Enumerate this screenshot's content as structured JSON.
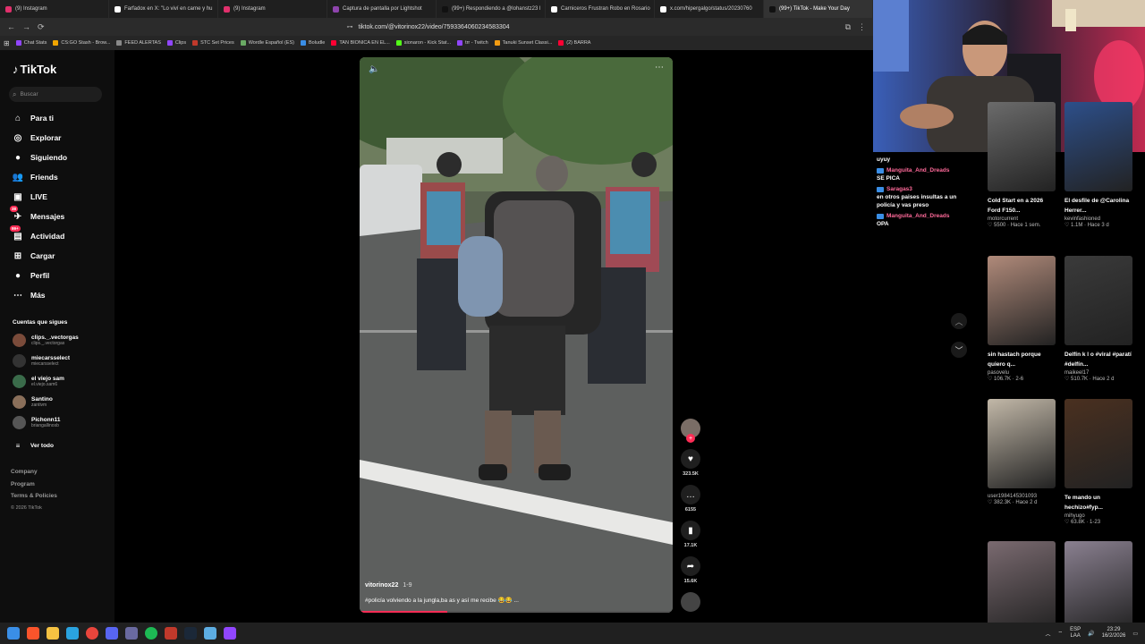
{
  "browser": {
    "tabs": [
      {
        "label": "(9) Instagram",
        "color": "#e1306c"
      },
      {
        "label": "Farfadox en X: \"Lo viví en carne y hu",
        "color": "#ffffff"
      },
      {
        "label": "(9) Instagram",
        "color": "#e1306c"
      },
      {
        "label": "Captura de pantalla por Lightshot",
        "color": "#8e44ad"
      },
      {
        "label": "(99+) Respondiendo a @lohanstz23 l",
        "color": "#111111"
      },
      {
        "label": "Carniceros Frustran Robo en Rosario",
        "color": "#ffffff"
      },
      {
        "label": "x.com/hipergalgo/status/20230760",
        "color": "#ffffff"
      },
      {
        "label": "(99+) TikTok - Make Your Day",
        "color": "#111111"
      }
    ],
    "url": "tiktok.com/@vitorinox22/video/7593364060234583304",
    "bookmarks": [
      {
        "label": "Chat Stats",
        "color": "#9146ff"
      },
      {
        "label": "CS:GO Stash - Brow...",
        "color": "#f0a500"
      },
      {
        "label": "FEED ALERTAS",
        "color": "#888888"
      },
      {
        "label": "Clips",
        "color": "#9146ff"
      },
      {
        "label": "STC Set Prices",
        "color": "#c0392b"
      },
      {
        "label": "Wordle Español (ES)",
        "color": "#6aaa64"
      },
      {
        "label": "Boludle",
        "color": "#3a8ee6"
      },
      {
        "label": "TAN BIONICA EN EL...",
        "color": "#ff0033"
      },
      {
        "label": "sionaron - Kick Stat...",
        "color": "#53fc18"
      },
      {
        "label": "trr - Twitch",
        "color": "#9146ff"
      },
      {
        "label": "Tanuki Sunset Classi...",
        "color": "#f39c12"
      },
      {
        "label": "(2) BARRA",
        "color": "#ff0033"
      }
    ]
  },
  "sidebar": {
    "logo": "TikTok",
    "search_placeholder": "Buscar",
    "nav": [
      {
        "label": "Para ti",
        "icon": "home-icon",
        "glyph": "⌂"
      },
      {
        "label": "Explorar",
        "icon": "compass-icon",
        "glyph": "◎"
      },
      {
        "label": "Siguiendo",
        "icon": "following-avatar-icon",
        "glyph": "●"
      },
      {
        "label": "Friends",
        "icon": "friends-icon",
        "glyph": "👥"
      },
      {
        "label": "LIVE",
        "icon": "live-icon",
        "glyph": "▣"
      },
      {
        "label": "Mensajes",
        "icon": "messages-icon",
        "glyph": "✈",
        "badge": "38"
      },
      {
        "label": "Actividad",
        "icon": "activity-icon",
        "glyph": "▤",
        "badge": "99+"
      },
      {
        "label": "Cargar",
        "icon": "upload-icon",
        "glyph": "⊞"
      },
      {
        "label": "Perfil",
        "icon": "profile-icon",
        "glyph": "●"
      },
      {
        "label": "Más",
        "icon": "more-icon",
        "glyph": "⋯"
      }
    ],
    "following_header": "Cuentas que sigues",
    "following": [
      {
        "name": "clips._.vectorgas",
        "handle": "clips._.vectorgas",
        "color": "#7a4b3a"
      },
      {
        "name": "miecarsselect",
        "handle": "miecarsselect",
        "color": "#333333"
      },
      {
        "name": "el viejo sam",
        "handle": "el.viejo.sam6",
        "color": "#3a6b4a"
      },
      {
        "name": "Santino",
        "handle": "zantivm",
        "color": "#8a6f5a"
      },
      {
        "name": "Pichonn11",
        "handle": "briangallinosb",
        "color": "#555555"
      }
    ],
    "see_all": "Ver todo",
    "footer": [
      "Company",
      "Program",
      "Terms & Policies",
      "© 2026 TikTok"
    ]
  },
  "video": {
    "author": "vitorinox22",
    "date": "1-9",
    "caption": "#policía volviendo a la jungla,ba as y así me recibe 😂😂 ...",
    "progress": 0.28
  },
  "actions": [
    {
      "icon": "heart-icon",
      "glyph": "♥",
      "count": "323.5K"
    },
    {
      "icon": "comment-icon",
      "glyph": "…",
      "count": "6155"
    },
    {
      "icon": "bookmark-icon",
      "glyph": "▮",
      "count": "17.1K"
    },
    {
      "icon": "share-icon",
      "glyph": "➦",
      "count": "15.6K"
    }
  ],
  "chat": [
    {
      "user": "",
      "text": "uyuy"
    },
    {
      "user": "Manguita_And_Dreads",
      "text": "SE PICA"
    },
    {
      "user": "Saragas3",
      "text": "en otros paises insultas a un policía y vas preso"
    },
    {
      "user": "Manguita_And_Dreads",
      "text": "OPA"
    }
  ],
  "feed": [
    {
      "title": "Cold Start en a 2026 Ford F150...",
      "user": "motorcurrent",
      "meta": "5500 · Hace 1 sem.",
      "color": "#6b6b6b"
    },
    {
      "title": "El desfile de @Carolina Herrer...",
      "user": "kevinfashioned",
      "meta": "1.1M · Hace 3 d",
      "color": "#2d4f8a"
    },
    {
      "title": "sin hastach porque quiero q...",
      "user": "pasovelu",
      "meta": "106.7K · 2-6",
      "color": "#b08a7a"
    },
    {
      "title": "Delfín k l o #viral #paratí #delfín...",
      "user": "maikeel17",
      "meta": "510.7K · Hace 2 d",
      "color": "#3a3a3a"
    },
    {
      "title": "",
      "user": "user1984145301093",
      "meta": "382.3K · Hace 2 d",
      "color": "#c2b8a8"
    },
    {
      "title": "Te mando un hechizo#fyp...",
      "user": "mihyugo",
      "meta": "63.8K · 1-23",
      "color": "#4a3020"
    },
    {
      "title": "",
      "user": "",
      "meta": "",
      "color": "#7a6a70"
    },
    {
      "title": "",
      "user": "",
      "meta": "",
      "color": "#8a8090"
    }
  ],
  "taskbar": {
    "lang_top": "ESP",
    "lang_bottom": "LAA",
    "time": "23:29",
    "date": "16/2/2026"
  }
}
